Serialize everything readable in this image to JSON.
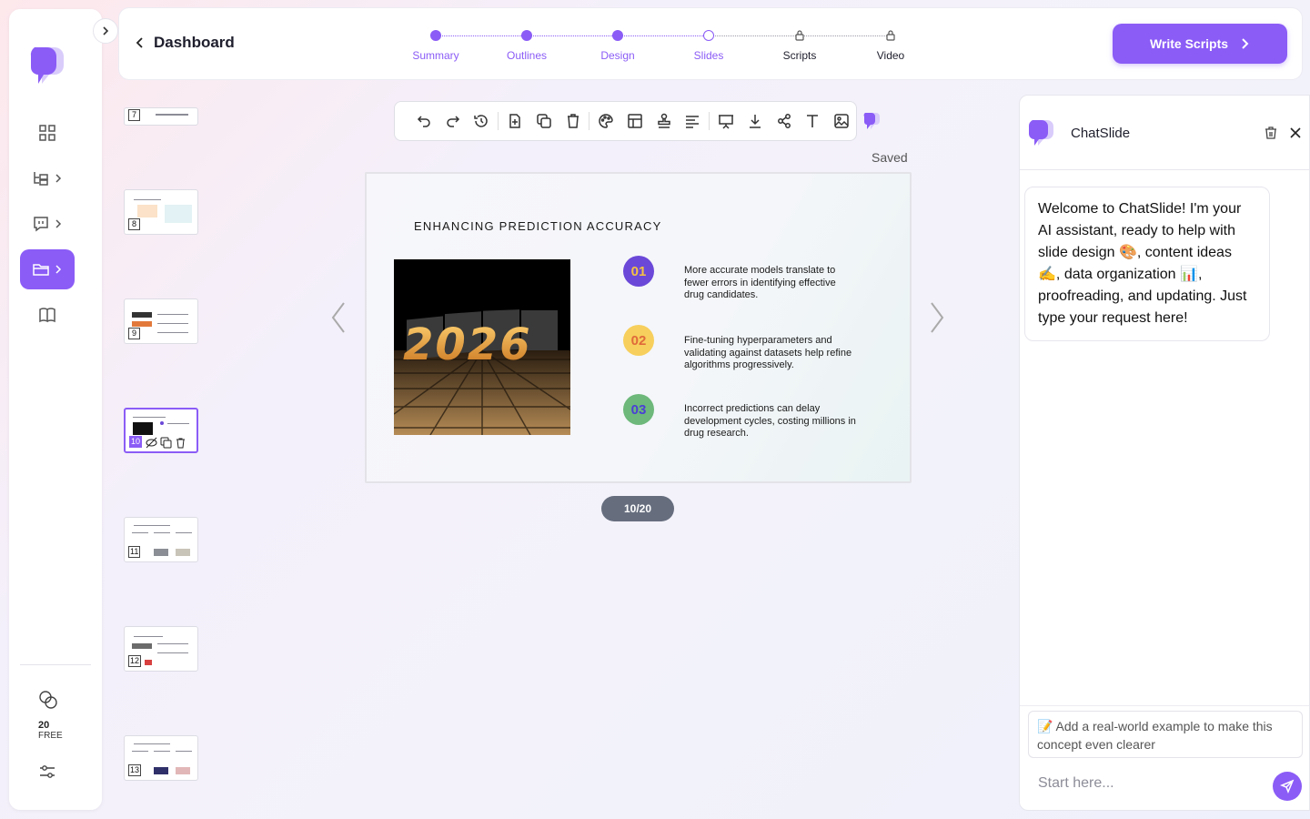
{
  "header": {
    "back_label": "Dashboard",
    "steps": [
      {
        "label": "Summary",
        "state": "done"
      },
      {
        "label": "Outlines",
        "state": "done"
      },
      {
        "label": "Design",
        "state": "done"
      },
      {
        "label": "Slides",
        "state": "current"
      },
      {
        "label": "Scripts",
        "state": "locked"
      },
      {
        "label": "Video",
        "state": "locked"
      }
    ],
    "write_scripts_label": "Write Scripts"
  },
  "sidebar": {
    "items": [
      {
        "icon": "grid-icon",
        "active": false
      },
      {
        "icon": "tree-icon",
        "active": false
      },
      {
        "icon": "chat-icon",
        "active": false
      },
      {
        "icon": "folder-icon",
        "active": true
      },
      {
        "icon": "book-icon",
        "active": false
      }
    ],
    "credits_count": "20",
    "credits_label": "FREE"
  },
  "thumbnails": [
    {
      "number": "7"
    },
    {
      "number": "8"
    },
    {
      "number": "9"
    },
    {
      "number": "10",
      "active": true
    },
    {
      "number": "11"
    },
    {
      "number": "12"
    },
    {
      "number": "13"
    }
  ],
  "toolbar": {
    "icons": [
      "undo-icon",
      "redo-icon",
      "history-icon",
      "add-slide-icon",
      "duplicate-icon",
      "delete-icon",
      "palette-icon",
      "layout-icon",
      "stamp-icon",
      "align-icon",
      "present-icon",
      "download-icon",
      "share-icon",
      "text-icon",
      "image-icon"
    ],
    "status": "Saved"
  },
  "slide": {
    "title": "ENHANCING PREDICTION ACCURACY",
    "image_text": "2026",
    "bullets": [
      {
        "num": "01",
        "text": "More accurate models translate to fewer errors in identifying effective drug candidates.",
        "bg": "#6b48d8",
        "fg": "#f5c242"
      },
      {
        "num": "02",
        "text": "Fine-tuning hyperparameters and validating against datasets help refine algorithms progressively.",
        "bg": "#f7cf5c",
        "fg": "#e0693a"
      },
      {
        "num": "03",
        "text": "Incorrect predictions can delay development cycles, costing millions in drug research.",
        "bg": "#6db87a",
        "fg": "#4b3fd6"
      }
    ],
    "pager": "10/20"
  },
  "chat": {
    "title": "ChatSlide",
    "welcome": "Welcome to ChatSlide! I'm your AI assistant, ready to help with slide design 🎨, content ideas ✍️, data organization 📊, proofreading, and updating. Just type your request here!",
    "suggestion": "📝 Add a real-world example to make this concept even clearer",
    "input_placeholder": "Start here..."
  },
  "colors": {
    "accent": "#8b5cf6"
  }
}
